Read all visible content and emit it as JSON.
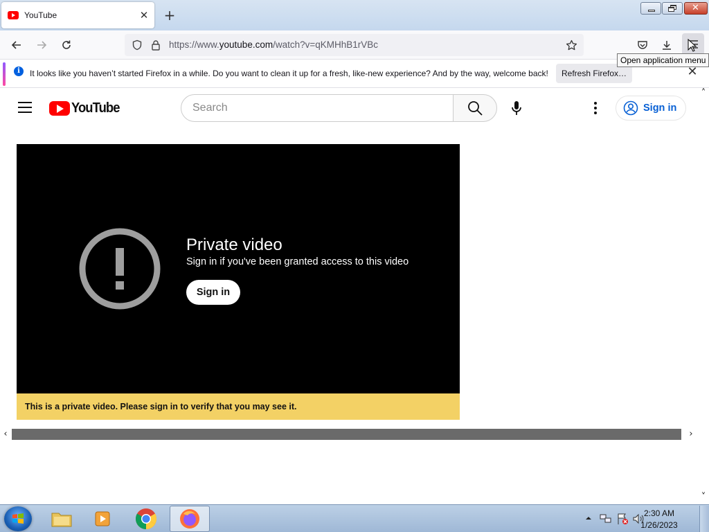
{
  "browser": {
    "tab_title": "YouTube",
    "url_prefix": "https://www.",
    "url_host": "youtube.com",
    "url_path": "/watch?v=qKMHhB1rVBc",
    "tooltip": "Open application menu"
  },
  "notification": {
    "message": "It looks like you haven’t started Firefox in a while. Do you want to clean it up for a fresh, like-new experience? And by the way, welcome back!",
    "button_label": "Refresh Firefox…"
  },
  "youtube": {
    "logo_text": "YouTube",
    "search_placeholder": "Search",
    "signin_label": "Sign in"
  },
  "player": {
    "title": "Private video",
    "subtitle": "Sign in if you've been granted access to this video",
    "signin_label": "Sign in",
    "banner": "This is a private video. Please sign in to verify that you may see it."
  },
  "taskbar": {
    "time": "2:30 AM",
    "date": "1/26/2023"
  },
  "colors": {
    "youtube_red": "#ff0000",
    "banner_yellow": "#f3d165",
    "link_blue": "#065fd4"
  }
}
